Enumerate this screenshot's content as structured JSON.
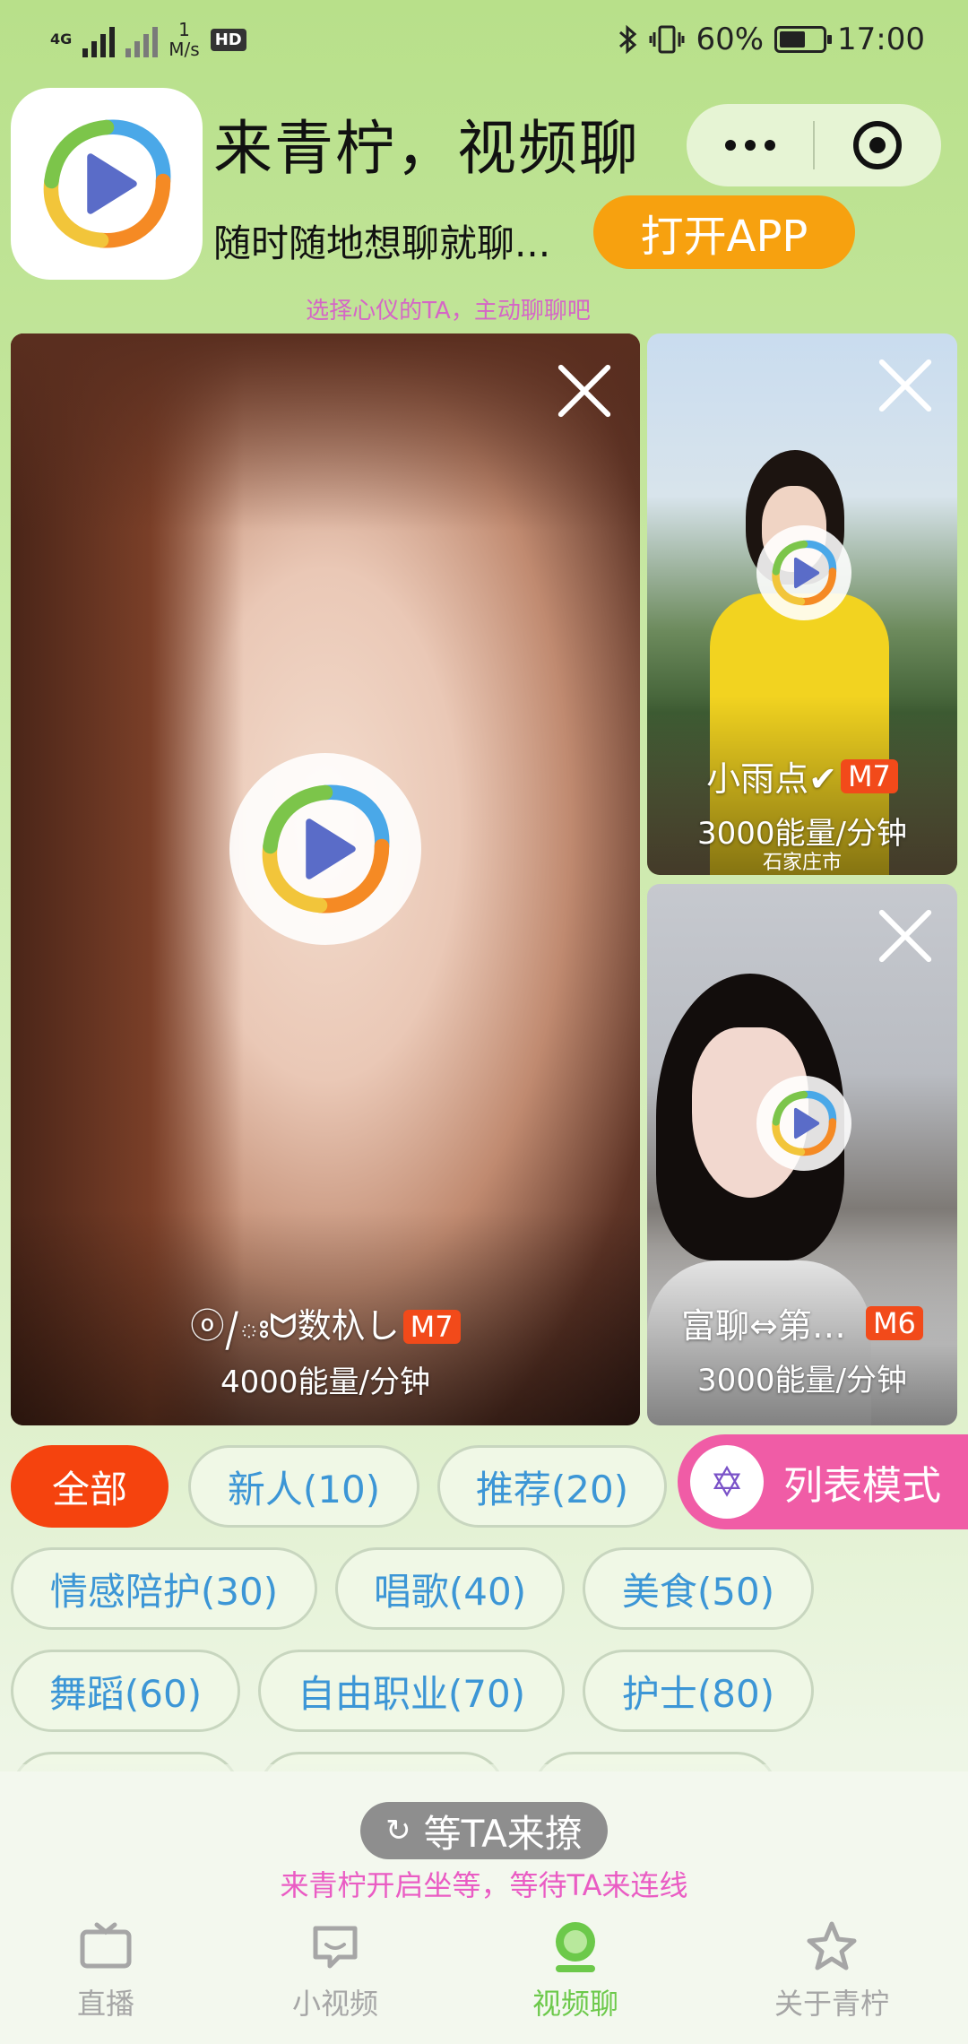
{
  "status_bar": {
    "network": "4G",
    "speed_value": "1",
    "speed_unit": "M/s",
    "hd": "HD",
    "battery": "60%",
    "battery_level": 0.6,
    "time": "17:00"
  },
  "header": {
    "title": "来青柠，视频聊",
    "subtitle": "随时随地想聊就聊...",
    "open_app": "打开APP",
    "tip": "选择心仪的TA，主动聊聊吧"
  },
  "cards": [
    {
      "name": "ⓞ/ఃᗢ数杁し",
      "level": "M7",
      "rate": "4000能量/分钟",
      "city": ""
    },
    {
      "name": "小雨点✔",
      "level": "M7",
      "rate": "3000能量/分钟",
      "city": "石家庄市"
    },
    {
      "name": "富聊⇔第…",
      "level": "M6",
      "rate": "3000能量/分钟",
      "city": ""
    }
  ],
  "tags": [
    "全部",
    "新人(10)",
    "推荐(20)",
    "情感陪护(30)",
    "唱歌(40)",
    "美食(50)",
    "舞蹈(60)",
    "自由职业(70)",
    "护士(80)"
  ],
  "list_mode": "列表模式",
  "wait": {
    "button": "等TA来撩",
    "tip": "来青柠开启坐等，等待TA来连线"
  },
  "tabbar": [
    "直播",
    "小视频",
    "视频聊",
    "关于青柠"
  ],
  "colors": {
    "accent_orange": "#f7a10f",
    "active_tag": "#f5430e",
    "tag_text": "#3c96d6",
    "list_mode": "#f05ca6",
    "tab_active": "#6cc94a"
  }
}
